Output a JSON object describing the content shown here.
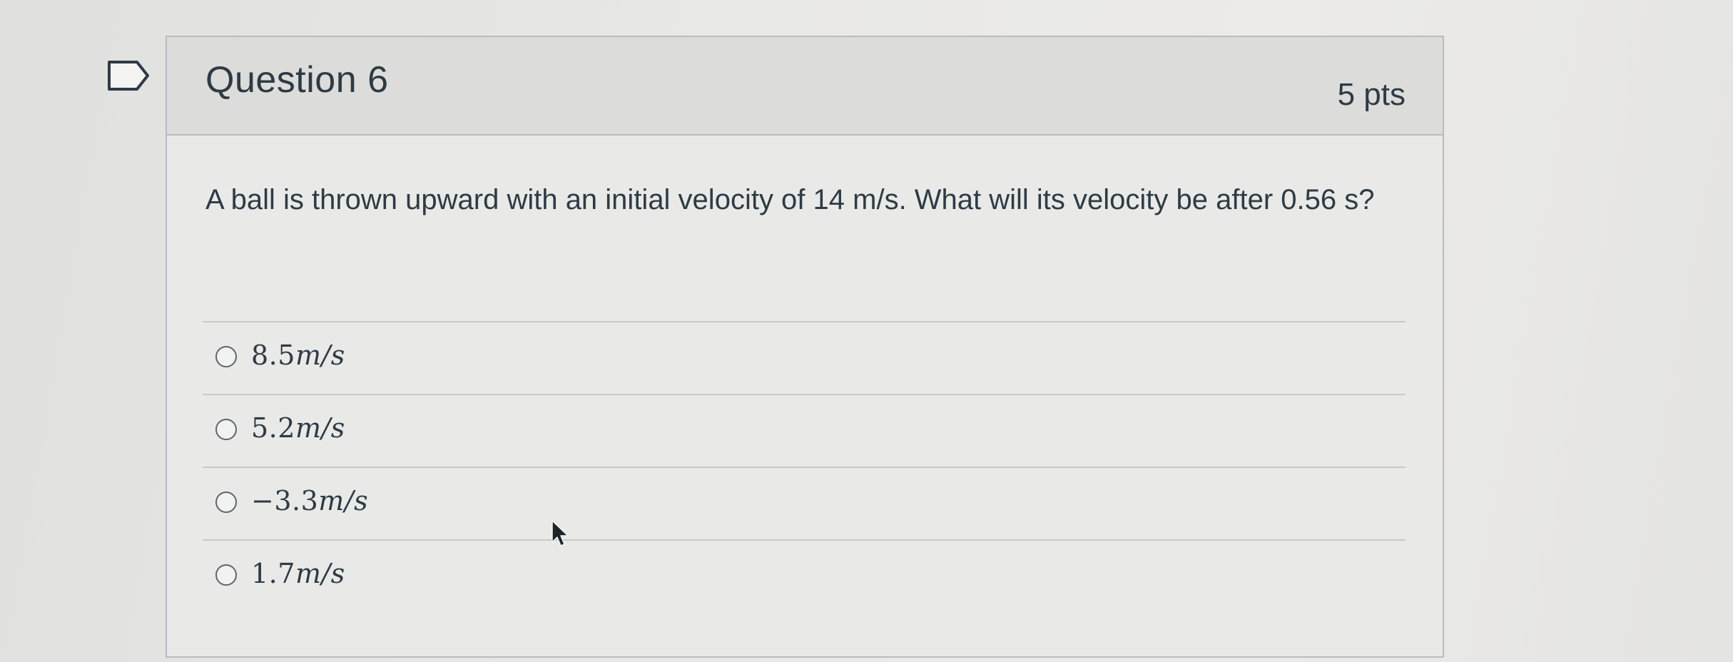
{
  "question": {
    "title": "Question 6",
    "points": "5 pts",
    "text": "A ball is thrown upward with an initial velocity of 14 m/s. What will its velocity be after 0.56 s?"
  },
  "answers": [
    {
      "value": "8.5",
      "unit": "m/s"
    },
    {
      "value": "5.2",
      "unit": "m/s"
    },
    {
      "value": "−3.3",
      "unit": "m/s"
    },
    {
      "value": "1.7",
      "unit": "m/s"
    }
  ],
  "icons": {
    "flag": "flag-question-icon",
    "cursor": "mouse-pointer-icon"
  },
  "colors": {
    "text": "#2d3b45",
    "border": "#b9bcbe",
    "header_bg": "#dcdcda"
  }
}
